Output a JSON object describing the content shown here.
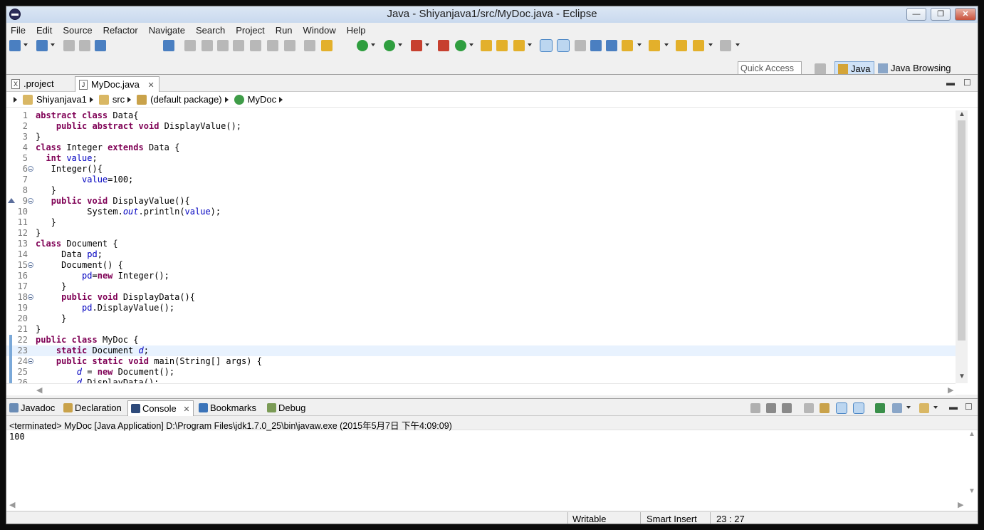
{
  "window": {
    "title": "Java - Shiyanjava1/src/MyDoc.java - Eclipse",
    "controls": [
      "—",
      "❐",
      "✕"
    ]
  },
  "menu": [
    "File",
    "Edit",
    "Source",
    "Refactor",
    "Navigate",
    "Search",
    "Project",
    "Run",
    "Window",
    "Help"
  ],
  "toolbar": {
    "quick_access": "Quick Access",
    "perspectives": [
      {
        "label": "Java",
        "active": true
      },
      {
        "label": "Java Browsing",
        "active": false
      }
    ]
  },
  "editor": {
    "tabs": [
      {
        "label": ".project",
        "icon": "X",
        "active": false
      },
      {
        "label": "MyDoc.java",
        "icon": "J",
        "active": true
      }
    ],
    "breadcrumb": [
      "Shiyanjava1",
      "src",
      "(default package)",
      "MyDoc"
    ],
    "lines": [
      {
        "n": "1",
        "html": "<span class='kw'>abstract</span> <span class='kw'>class</span> Data{"
      },
      {
        "n": "2",
        "html": "    <span class='kw'>public</span> <span class='kw'>abstract</span> <span class='kw'>void</span> DisplayValue();"
      },
      {
        "n": "3",
        "html": "}"
      },
      {
        "n": "4",
        "html": "<span class='kw'>class</span> Integer <span class='kw'>extends</span> Data {"
      },
      {
        "n": "5",
        "html": "  <span class='kw'>int</span> <span class='fld'>value</span>;"
      },
      {
        "n": "6",
        "html": "   Integer(){",
        "fold": true
      },
      {
        "n": "7",
        "html": "         <span class='fld'>value</span>=100;"
      },
      {
        "n": "8",
        "html": "   }"
      },
      {
        "n": "9",
        "html": "   <span class='kw'>public</span> <span class='kw'>void</span> DisplayValue(){",
        "fold": true,
        "override": true
      },
      {
        "n": "10",
        "html": "          System.<span class='st'>out</span>.println(<span class='fld'>value</span>);"
      },
      {
        "n": "11",
        "html": "   }"
      },
      {
        "n": "12",
        "html": "}"
      },
      {
        "n": "13",
        "html": "<span class='kw'>class</span> Document {"
      },
      {
        "n": "14",
        "html": "     Data <span class='fld'>pd</span>;"
      },
      {
        "n": "15",
        "html": "     Document() {",
        "fold": true
      },
      {
        "n": "16",
        "html": "         <span class='fld'>pd</span>=<span class='kw'>new</span> Integer();"
      },
      {
        "n": "17",
        "html": "     }"
      },
      {
        "n": "18",
        "html": "     <span class='kw'>public</span> <span class='kw'>void</span> DisplayData(){",
        "fold": true
      },
      {
        "n": "19",
        "html": "         <span class='fld'>pd</span>.DisplayValue();"
      },
      {
        "n": "20",
        "html": "     }"
      },
      {
        "n": "21",
        "html": "}"
      },
      {
        "n": "22",
        "html": "<span class='kw'>public</span> <span class='kw'>class</span> MyDoc {",
        "mark": true
      },
      {
        "n": "23",
        "html": "    <span class='kw'>static</span> Document <span class='st'>d</span>;",
        "mark": true,
        "current": true
      },
      {
        "n": "24",
        "html": "    <span class='kw'>public</span> <span class='kw'>static</span> <span class='kw'>void</span> main(String[] args) {",
        "fold": true,
        "mark": true
      },
      {
        "n": "25",
        "html": "        <span class='st'>d</span> = <span class='kw'>new</span> Document();",
        "mark": true
      },
      {
        "n": "26",
        "html": "        <span class='st'>d</span>.DisplayData();",
        "mark": true
      }
    ]
  },
  "console": {
    "tabs": [
      {
        "label": "Javadoc",
        "icon": "at-icon",
        "active": false
      },
      {
        "label": "Declaration",
        "icon": "declaration-icon",
        "active": false
      },
      {
        "label": "Console",
        "icon": "console-icon",
        "active": true
      },
      {
        "label": "Bookmarks",
        "icon": "bookmark-icon",
        "active": false
      },
      {
        "label": "Debug",
        "icon": "bug-icon",
        "active": false
      }
    ],
    "header": "<terminated> MyDoc [Java Application] D:\\Program Files\\jdk1.7.0_25\\bin\\javaw.exe (2015年5月7日 下午4:09:09)",
    "output": "100"
  },
  "status": {
    "mode": "Writable",
    "insert": "Smart Insert",
    "position": "23 : 27"
  }
}
